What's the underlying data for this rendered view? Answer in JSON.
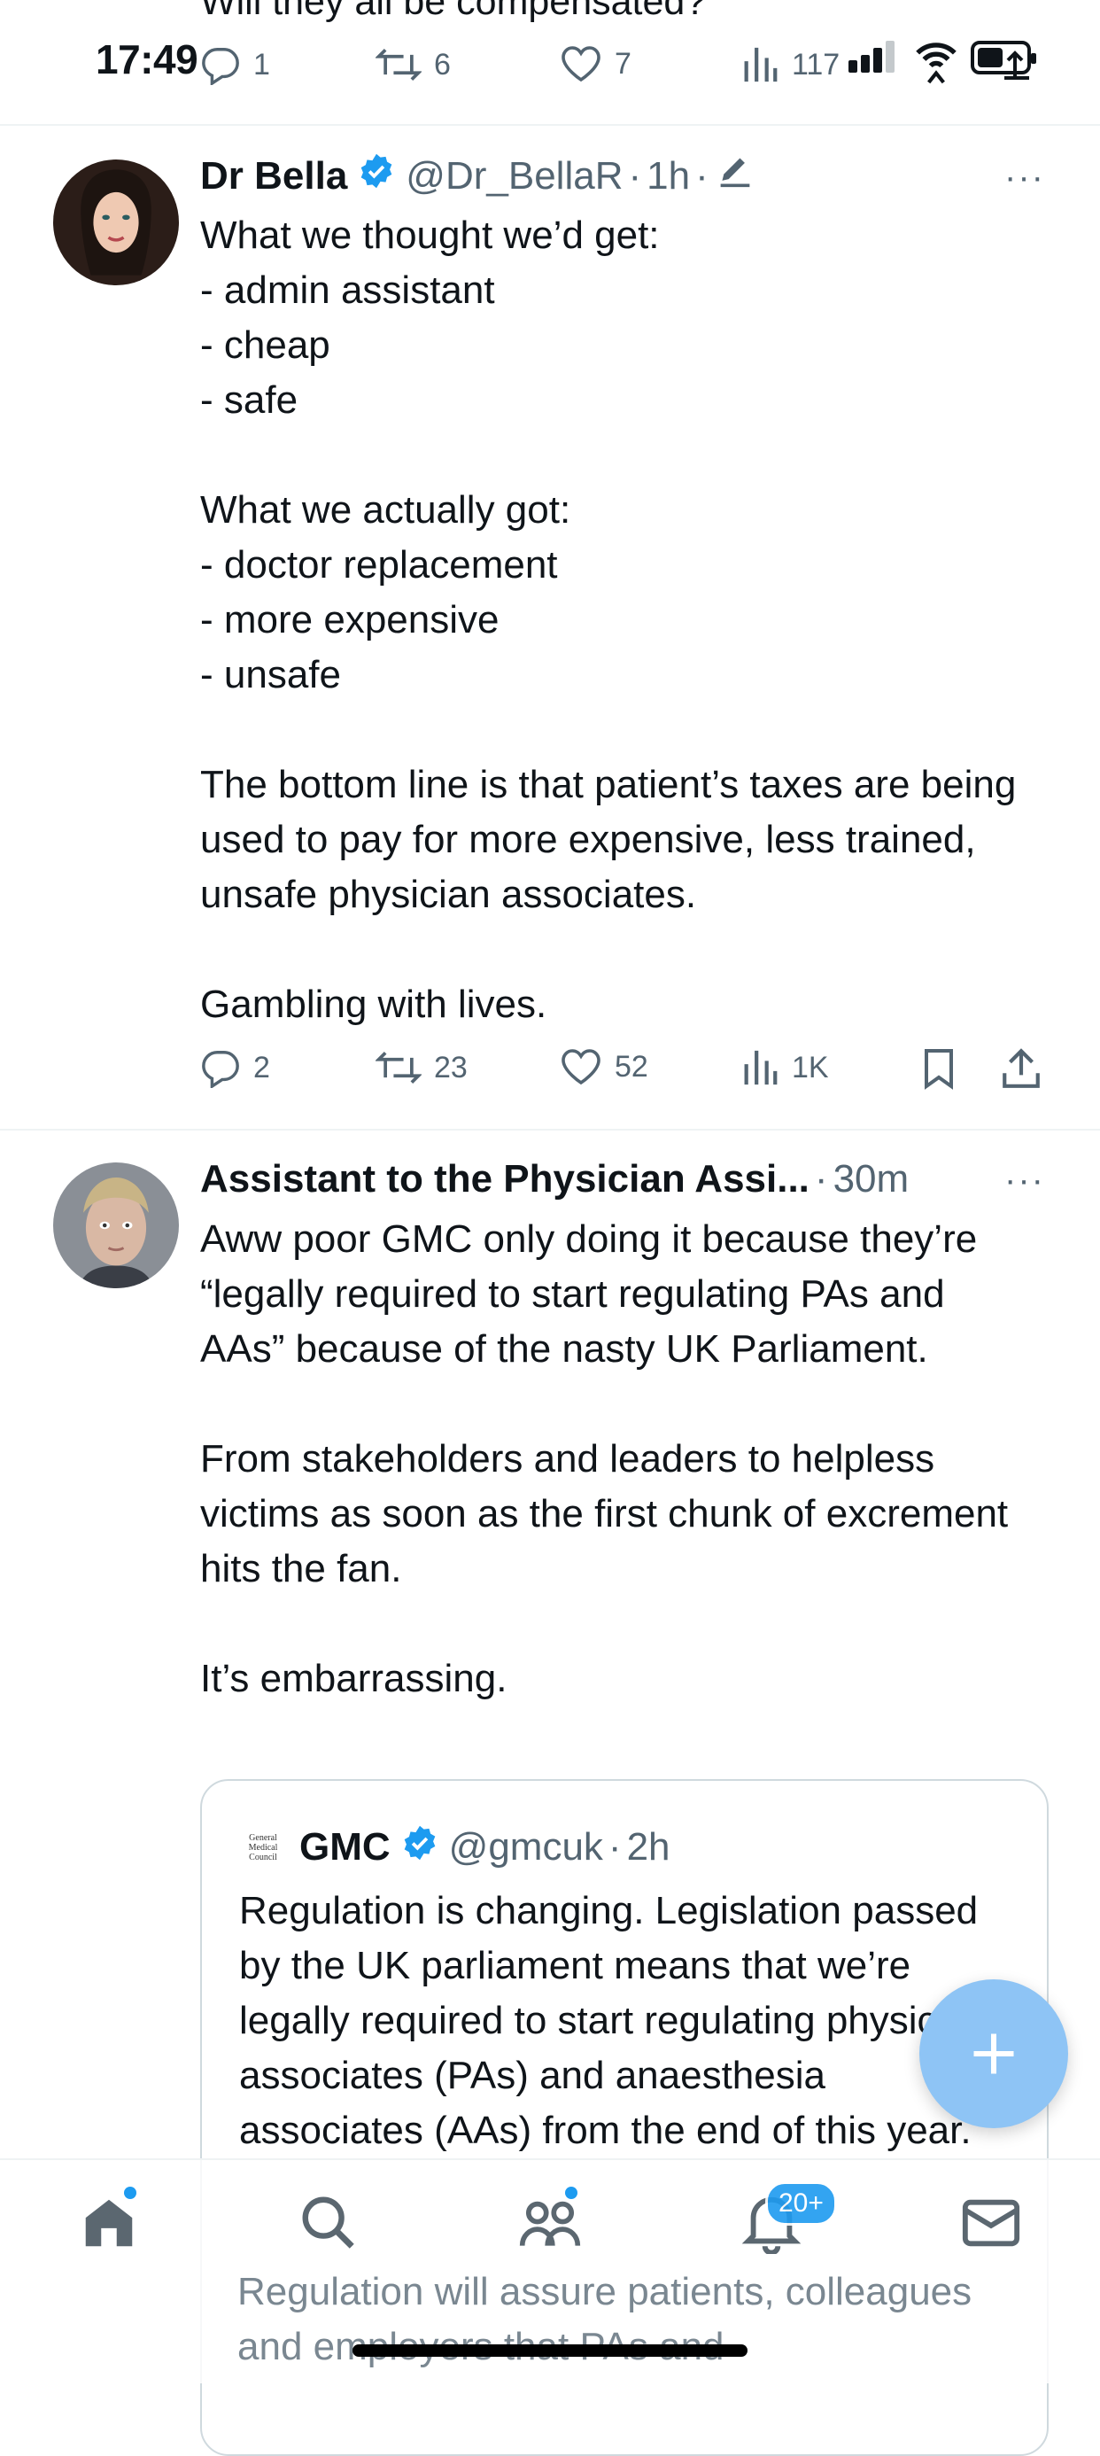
{
  "status_bar": {
    "time": "17:49",
    "signal_bars": 3,
    "battery_icon": "battery-icon"
  },
  "previous_tweet": {
    "cut_text": "Will they all be compensated?",
    "actions": {
      "replies": "1",
      "retweets": "6",
      "likes": "7",
      "views": "117"
    }
  },
  "tweets": [
    {
      "author": "Dr Bella",
      "verified": true,
      "handle": "@Dr_BellaR",
      "time": "1h",
      "edited": true,
      "more": "···",
      "body": [
        "What we thought we’d get:",
        "- admin assistant",
        "- cheap",
        "- safe",
        "",
        "What we actually got:",
        "- doctor replacement",
        "- more expensive",
        "- unsafe",
        "",
        "The bottom line is that patient’s taxes are being used to pay for more expensive, less trained, unsafe physician associates.",
        "",
        "Gambling with lives."
      ],
      "actions": {
        "replies": "2",
        "retweets": "23",
        "likes": "52",
        "views": "1K"
      }
    },
    {
      "author": "Assistant to the Physician Assi...",
      "handle": "",
      "time": "30m",
      "more": "···",
      "body": [
        "Aww poor GMC only doing it because they’re “legally required to start regulating PAs and AAs” because of the nasty UK Parliament.",
        "",
        "From stakeholders and leaders to helpless victims as soon as the first chunk of excrement hits the fan.",
        "",
        "It’s embarrassing."
      ],
      "quote": {
        "logo_text": [
          "General",
          "Medical",
          "Council"
        ],
        "author": "GMC",
        "verified": true,
        "handle": "@gmcuk",
        "time": "2h",
        "body": "Regulation is changing. Legislation passed by the UK parliament means that we’re legally required to start regulating physician associates (PAs) and anaesthesia associates (AAs) from the end of this year.",
        "body_continued": "Regulation will assure patients, colleagues and employers that PAs and"
      }
    }
  ],
  "bottom_nav": {
    "items": [
      "home-icon",
      "search-icon",
      "communities-icon",
      "notifications-icon",
      "messages-icon"
    ],
    "notifications_badge": "20+"
  },
  "fab": {
    "icon": "plus-icon"
  },
  "colors": {
    "accent": "#1d9bf0",
    "fab": "#8ec4f5",
    "text_primary": "#0f1419",
    "text_secondary": "#536471",
    "divider": "#eff3f4"
  }
}
